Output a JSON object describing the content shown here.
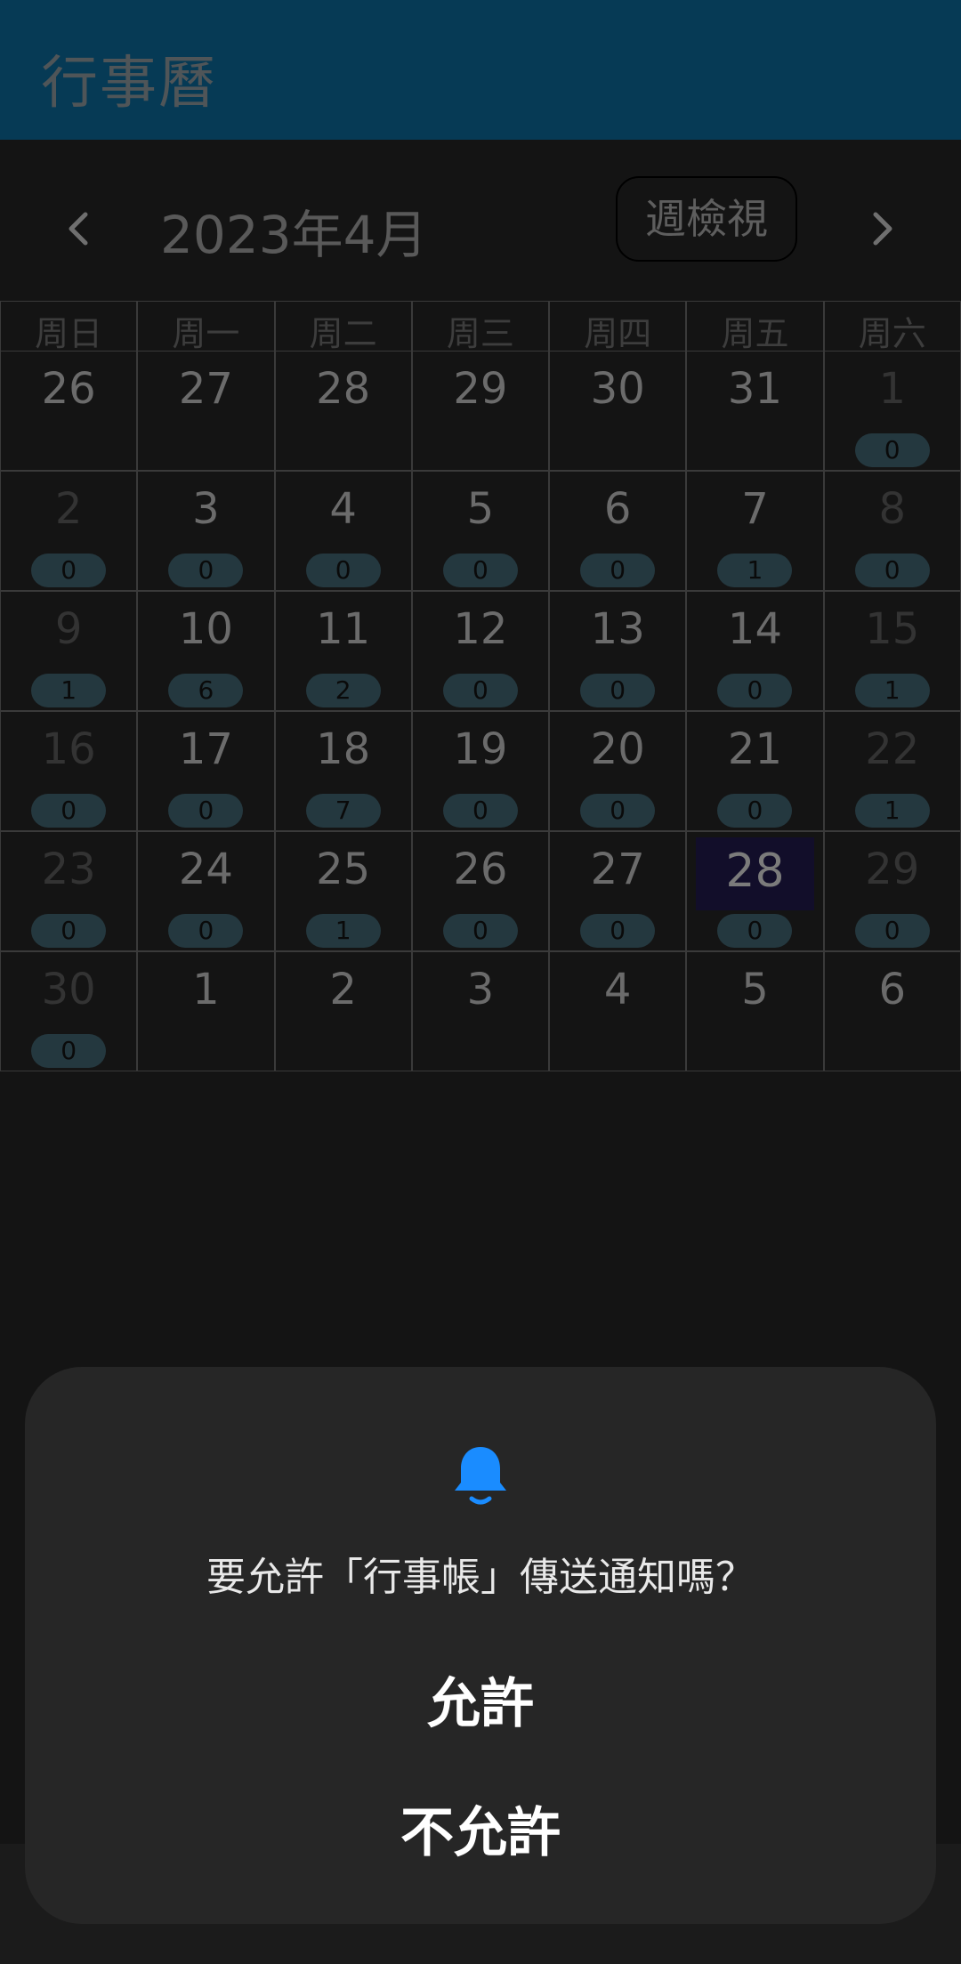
{
  "app_bar": {
    "title": "行事曆"
  },
  "nav": {
    "month_title": "2023年4月",
    "view_toggle_label": "週檢視"
  },
  "calendar": {
    "weekday_headers": [
      "周日",
      "周一",
      "周二",
      "周三",
      "周四",
      "周五",
      "周六"
    ],
    "weeks": [
      [
        {
          "day": "26",
          "count": null,
          "muted": false
        },
        {
          "day": "27",
          "count": null,
          "muted": false
        },
        {
          "day": "28",
          "count": null,
          "muted": false
        },
        {
          "day": "29",
          "count": null,
          "muted": false
        },
        {
          "day": "30",
          "count": null,
          "muted": false
        },
        {
          "day": "31",
          "count": null,
          "muted": false
        },
        {
          "day": "1",
          "count": "0",
          "muted": true
        }
      ],
      [
        {
          "day": "2",
          "count": "0",
          "muted": true
        },
        {
          "day": "3",
          "count": "0",
          "muted": false
        },
        {
          "day": "4",
          "count": "0",
          "muted": false
        },
        {
          "day": "5",
          "count": "0",
          "muted": false
        },
        {
          "day": "6",
          "count": "0",
          "muted": false
        },
        {
          "day": "7",
          "count": "1",
          "muted": false
        },
        {
          "day": "8",
          "count": "0",
          "muted": true
        }
      ],
      [
        {
          "day": "9",
          "count": "1",
          "muted": true
        },
        {
          "day": "10",
          "count": "6",
          "muted": false
        },
        {
          "day": "11",
          "count": "2",
          "muted": false
        },
        {
          "day": "12",
          "count": "0",
          "muted": false
        },
        {
          "day": "13",
          "count": "0",
          "muted": false
        },
        {
          "day": "14",
          "count": "0",
          "muted": false
        },
        {
          "day": "15",
          "count": "1",
          "muted": true
        }
      ],
      [
        {
          "day": "16",
          "count": "0",
          "muted": true
        },
        {
          "day": "17",
          "count": "0",
          "muted": false
        },
        {
          "day": "18",
          "count": "7",
          "muted": false
        },
        {
          "day": "19",
          "count": "0",
          "muted": false
        },
        {
          "day": "20",
          "count": "0",
          "muted": false
        },
        {
          "day": "21",
          "count": "0",
          "muted": false
        },
        {
          "day": "22",
          "count": "1",
          "muted": true
        }
      ],
      [
        {
          "day": "23",
          "count": "0",
          "muted": true
        },
        {
          "day": "24",
          "count": "0",
          "muted": false
        },
        {
          "day": "25",
          "count": "1",
          "muted": false
        },
        {
          "day": "26",
          "count": "0",
          "muted": false
        },
        {
          "day": "27",
          "count": "0",
          "muted": false
        },
        {
          "day": "28",
          "count": "0",
          "muted": false,
          "today": true
        },
        {
          "day": "29",
          "count": "0",
          "muted": true
        }
      ],
      [
        {
          "day": "30",
          "count": "0",
          "muted": true
        },
        {
          "day": "1",
          "count": null,
          "muted": false
        },
        {
          "day": "2",
          "count": null,
          "muted": false
        },
        {
          "day": "3",
          "count": null,
          "muted": false
        },
        {
          "day": "4",
          "count": null,
          "muted": false
        },
        {
          "day": "5",
          "count": null,
          "muted": false
        },
        {
          "day": "6",
          "count": null,
          "muted": false
        }
      ]
    ]
  },
  "dialog": {
    "icon": "bell-icon",
    "question": "要允許「行事帳」傳送通知嗎？",
    "allow_label": "允許",
    "deny_label": "不允許"
  },
  "colors": {
    "app_bar": "#063a55",
    "badge": "#24383f",
    "today_highlight": "#120e2a",
    "bell": "#1a8cff",
    "dialog": "#262626"
  }
}
